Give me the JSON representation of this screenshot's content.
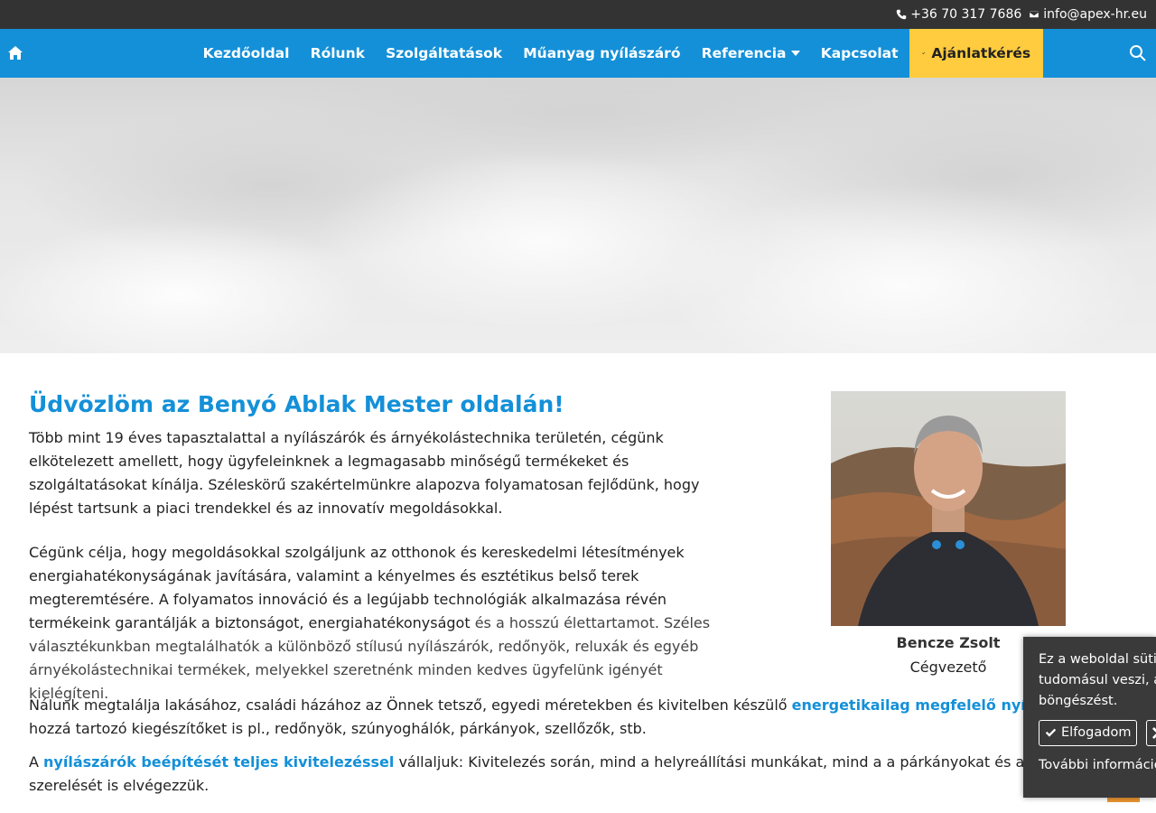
{
  "topbar": {
    "phone": "+36 70 317 7686",
    "email": "info@apex-hr.eu"
  },
  "nav": {
    "items": [
      {
        "label": "Kezdőoldal"
      },
      {
        "label": "Rólunk"
      },
      {
        "label": "Szolgáltatások"
      },
      {
        "label": "Műanyag nyílászáró"
      },
      {
        "label": "Referencia"
      },
      {
        "label": "Kapcsolat"
      }
    ],
    "cta_label": "Ajánlatkérés"
  },
  "main": {
    "title": "Üdvözlöm az Benyó Ablak Mester oldalán!",
    "p1": "Több mint 19 éves tapasztalattal a nyílászárók és árnyékolástechnika területén, cégünk elkötelezett amellett, hogy ügyfeleinknek a legmagasabb minőségű termékeket és szolgáltatásokat kínálja. Széleskörű szakértelmünkre alapozva folyamatosan fejlődünk, hogy lépést tartsunk a piaci trendekkel és az innovatív megoldásokkal.",
    "p2a": "Cégünk célja, hogy megoldásokkal szolgáljunk az otthonok és kereskedelmi létesítmények energiahatékonyságának javítására, valamint a kényelmes és esztétikus belső terek megteremtésére. A folyamatos innováció és a legújabb technológiák alkalmazása révén termékeink garantálják a biztonságot, energiahatékonyságot",
    "p2b": " és a hosszú élettartamot. Széles választékunkban megtalálhatók a különböző stílusú nyílászárók, redőnyök, reluxák és egyéb árnyékolástechnikai termékek, melyekkel szeretnénk minden kedves ügyfelünk igényét kielégíteni.",
    "p3a": "Nálunk megtalálja lakásához, családi házához az Önnek tetsző, egyedi méretekben és kivitelben készülő ",
    "p3link": "energetikailag megfelelő nyílászárókat",
    "p3b": " és a hozzá tartozó kiegészítőket is pl., redőnyök, szúnyoghálók, párkányok, szellőzők, stb.",
    "p4a": "A ",
    "p4link": "nyílászárók beépítését teljes kivitelezéssel",
    "p4b": " vállaljuk: Kivitelezés során, mind a helyreállítási munkákat, mind a a párkányokat és a kiegészítők szerelését is elvégezzük."
  },
  "person": {
    "name": "Bencze Zsolt",
    "role": "Cégvezető"
  },
  "cookie": {
    "text_line1": "Ez a weboldal sütiket használ.",
    "text_line2": "tudomásul veszi, amennyiben",
    "text_line3": "böngészést.",
    "accept_label": "Elfogadom",
    "more_label": "További információ"
  },
  "colors": {
    "brand_blue": "#1490d8",
    "cta_yellow": "#ffcc3f",
    "topbar": "#333333"
  }
}
